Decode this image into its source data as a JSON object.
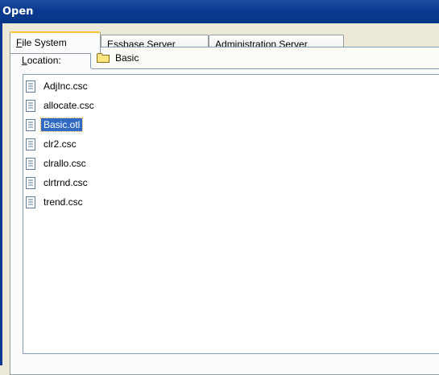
{
  "window": {
    "title": "Open"
  },
  "tabs": [
    {
      "label": "File System",
      "accesskey": "F",
      "rest": "ile System",
      "active": true
    },
    {
      "label": "Essbase Server",
      "accesskey": "E",
      "rest": "ssbase Server",
      "active": false
    },
    {
      "label": "Administration Server",
      "accesskey": "A",
      "rest": "dministration Server",
      "active": false
    }
  ],
  "location": {
    "label": "Location:",
    "accesskey": "L",
    "rest": "ocation:",
    "value": "Basic",
    "icon": "folder-icon"
  },
  "files": [
    {
      "name": "AdjInc.csc",
      "icon": "document-icon",
      "selected": false
    },
    {
      "name": "allocate.csc",
      "icon": "document-icon",
      "selected": false
    },
    {
      "name": "Basic.otl",
      "icon": "document-icon",
      "selected": true
    },
    {
      "name": "clr2.csc",
      "icon": "document-icon",
      "selected": false
    },
    {
      "name": "clrallo.csc",
      "icon": "document-icon",
      "selected": false
    },
    {
      "name": "clrtrnd.csc",
      "icon": "document-icon",
      "selected": false
    },
    {
      "name": "trend.csc",
      "icon": "document-icon",
      "selected": false
    }
  ]
}
